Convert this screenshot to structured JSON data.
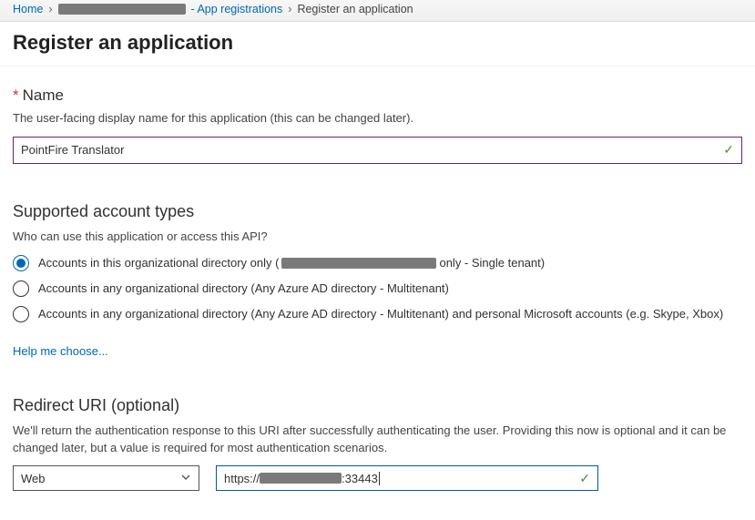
{
  "breadcrumbs": {
    "home": "Home",
    "appreg": "- App registrations",
    "current": "Register an application"
  },
  "page_title": "Register an application",
  "name_section": {
    "label": "Name",
    "help": "The user-facing display name for this application (this can be changed later).",
    "value": "PointFire Translator"
  },
  "acct_section": {
    "title": "Supported account types",
    "help": "Who can use this application or access this API?",
    "options": [
      {
        "pre": "Accounts in this organizational directory only (",
        "post": " only - Single tenant)"
      },
      {
        "label": "Accounts in any organizational directory (Any Azure AD directory - Multitenant)"
      },
      {
        "label": "Accounts in any organizational directory (Any Azure AD directory - Multitenant) and personal Microsoft accounts (e.g. Skype, Xbox)"
      }
    ],
    "help_link": "Help me choose..."
  },
  "redirect_section": {
    "title": "Redirect URI (optional)",
    "help": "We'll return the authentication response to this URI after successfully authenticating the user. Providing this now is optional and it can be changed later, but a value is required for most authentication scenarios.",
    "platform": "Web",
    "uri_prefix": "https://",
    "uri_suffix": ":33443"
  }
}
